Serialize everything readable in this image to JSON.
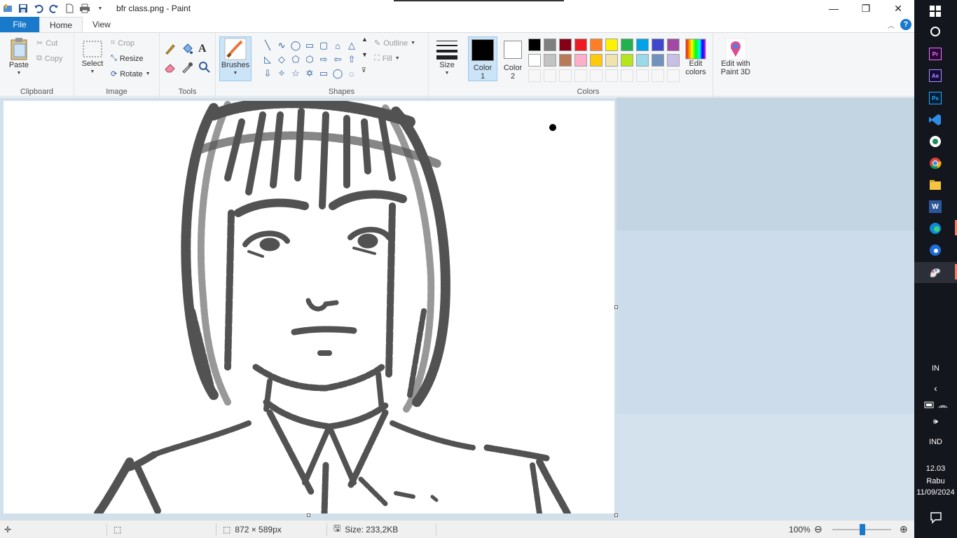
{
  "window": {
    "title": "bfr class.png - Paint",
    "minimize": "—",
    "maximize": "❐",
    "close": "✕"
  },
  "tabs": {
    "file": "File",
    "home": "Home",
    "view": "View"
  },
  "clipboard": {
    "paste": "Paste",
    "cut": "Cut",
    "copy": "Copy",
    "label": "Clipboard"
  },
  "image": {
    "select": "Select",
    "crop": "Crop",
    "resize": "Resize",
    "rotate": "Rotate",
    "label": "Image"
  },
  "tools": {
    "label": "Tools",
    "text_glyph": "A"
  },
  "brushes": {
    "label": "Brushes"
  },
  "shapes": {
    "outline": "Outline",
    "fill": "Fill",
    "label": "Shapes",
    "items": [
      "╲",
      "∿",
      "◯",
      "▭",
      "▢",
      "⌂",
      "△",
      "◺",
      "◇",
      "⬠",
      "⬡",
      "⇨",
      "⇦",
      "⇧",
      "⇩",
      "✧",
      "☆",
      "✡",
      "▭",
      "◯",
      "◌"
    ]
  },
  "size": {
    "label": "Size"
  },
  "colors": {
    "color1_line1": "Color",
    "color1_line2": "1",
    "color2_line1": "Color",
    "color2_line2": "2",
    "label": "Colors",
    "color1_value": "#000000",
    "color2_value": "#ffffff",
    "edit_line1": "Edit",
    "edit_line2": "colors",
    "paint3d_line1": "Edit with",
    "paint3d_line2": "Paint 3D",
    "palette_row1": [
      "#000000",
      "#7f7f7f",
      "#880015",
      "#ed1c24",
      "#ff7f27",
      "#fff200",
      "#22b14c",
      "#00a2e8",
      "#3f48cc",
      "#a349a4"
    ],
    "palette_row2": [
      "#ffffff",
      "#c3c3c3",
      "#b97a57",
      "#ffaec9",
      "#ffc90e",
      "#efe4b0",
      "#b5e61d",
      "#99d9ea",
      "#7092be",
      "#c8bfe7"
    ]
  },
  "status": {
    "dimensions": "872 × 589px",
    "size": "Size: 233,2KB",
    "zoom": "100%",
    "zoom_level": 1.0
  },
  "taskbar": {
    "lang": "IN",
    "ind": "IND",
    "time": "12.03",
    "day": "Rabu",
    "date": "11/09/2024",
    "apps": [
      "Pr",
      "Ae",
      "Ps",
      "VS",
      "Chat",
      "Chrome",
      "Files",
      "W",
      "Edge",
      "Edge Beta",
      "Paint"
    ]
  }
}
